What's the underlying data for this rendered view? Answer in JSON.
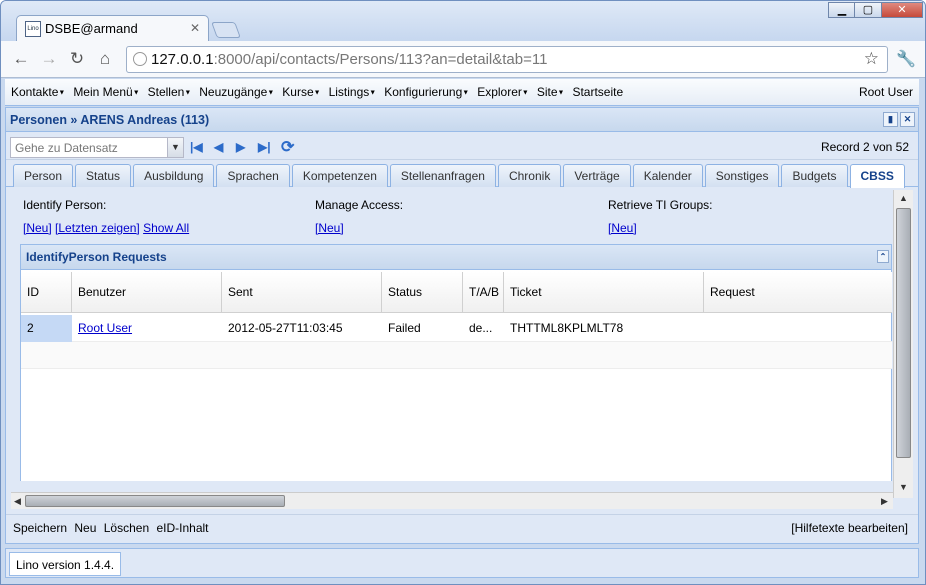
{
  "browser": {
    "tab_title": "DSBE@armand",
    "tab_icon": "Lino",
    "url_host": "127.0.0.1",
    "url_rest": ":8000/api/contacts/Persons/113?an=detail&tab=11"
  },
  "menubar": {
    "items": [
      "Kontakte",
      "Mein Menü",
      "Stellen",
      "Neuzugänge",
      "Kurse",
      "Listings",
      "Konfigurierung",
      "Explorer",
      "Site"
    ],
    "home": "Startseite",
    "user": "Root User"
  },
  "panel": {
    "title": "Personen » ARENS Andreas (113)",
    "goto_placeholder": "Gehe zu Datensatz",
    "record": "Record 2 von 52",
    "tabs": [
      "Person",
      "Status",
      "Ausbildung",
      "Sprachen",
      "Kompetenzen",
      "Stellenanfragen",
      "Chronik",
      "Verträge",
      "Kalender",
      "Sonstiges",
      "Budgets",
      "CBSS"
    ],
    "active_tab": "CBSS"
  },
  "cbss": {
    "identify_label": "Identify Person:",
    "identify_links": [
      "[Neu]",
      "[Letzten zeigen]",
      "Show All"
    ],
    "manage_label": "Manage Access:",
    "manage_link": "[Neu]",
    "retrieve_label": "Retrieve TI Groups:",
    "retrieve_link": "[Neu]"
  },
  "grid": {
    "title": "IdentifyPerson Requests",
    "columns": [
      "ID",
      "Benutzer",
      "Sent",
      "Status",
      "T/A/B",
      "Ticket",
      "Request"
    ],
    "rows": [
      {
        "id": "2",
        "benutzer": "Root User",
        "sent": "2012-05-27T11:03:45",
        "status": "Failed",
        "tab": "de...",
        "ticket": "THTTML8KPLMLT78",
        "request": ""
      }
    ]
  },
  "bottombar": {
    "actions": [
      "Speichern",
      "Neu",
      "Löschen",
      "eID-Inhalt"
    ],
    "help": "[Hilfetexte bearbeiten]"
  },
  "status": {
    "version": "Lino version 1.4.4."
  }
}
